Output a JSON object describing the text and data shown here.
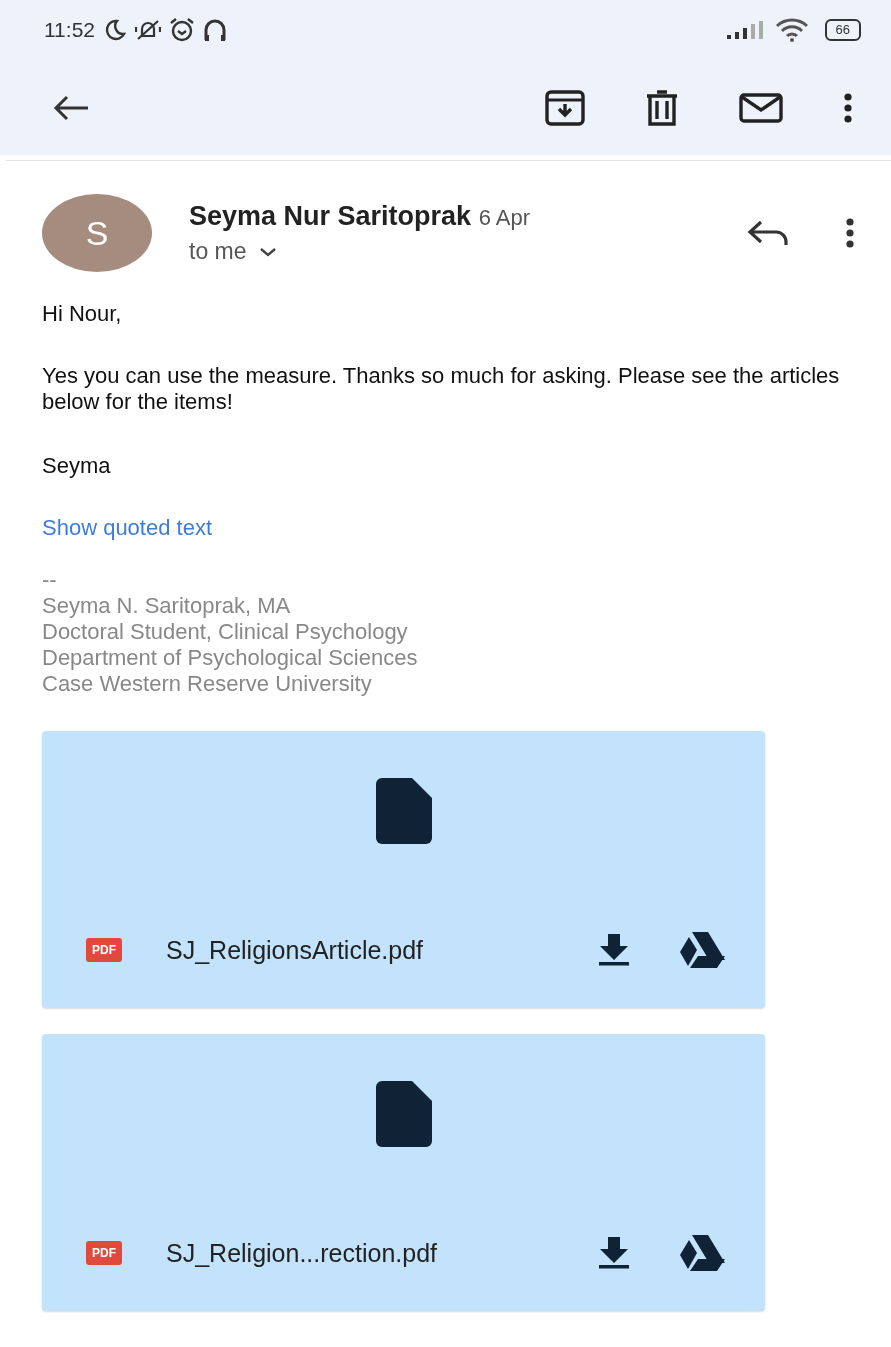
{
  "status_bar": {
    "time": "11:52",
    "battery": "66"
  },
  "message": {
    "sender_initial": "S",
    "sender": "Seyma Nur Saritoprak",
    "date": "6 Apr",
    "recipient": "to me"
  },
  "body": {
    "greeting": "Hi Nour,",
    "paragraph": "Yes you can use the measure. Thanks so much for asking. Please see the articles below for the items!",
    "closing": "Seyma",
    "show_quoted": "Show quoted text"
  },
  "signature": [
    "--",
    "Seyma N. Saritoprak, MA",
    "Doctoral Student, Clinical Psychology",
    "Department of Psychological Sciences",
    "Case Western Reserve University"
  ],
  "attachments": [
    {
      "type_badge": "PDF",
      "filename": "SJ_ReligionsArticle.pdf"
    },
    {
      "type_badge": "PDF",
      "filename": "SJ_Religion...rection.pdf"
    }
  ]
}
